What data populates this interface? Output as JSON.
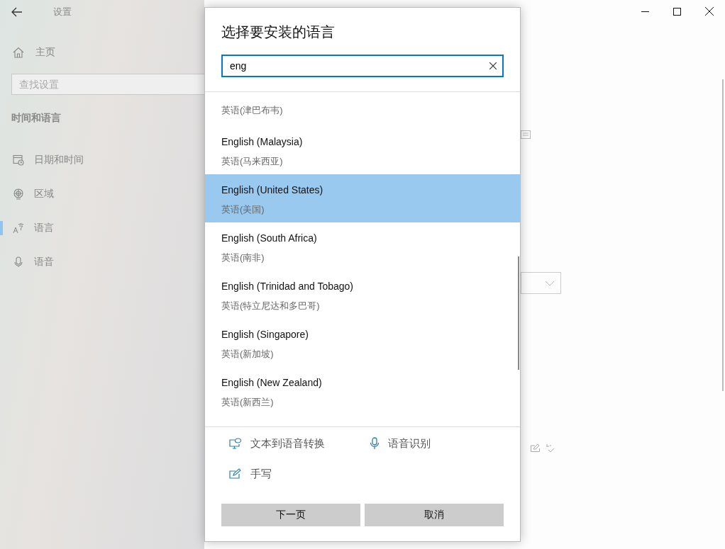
{
  "window": {
    "title": "设置"
  },
  "sidebar": {
    "home": "主页",
    "search": {
      "placeholder": "查找设置"
    },
    "section": "时间和语言",
    "items": [
      {
        "label": "日期和时间",
        "kind": "datetime",
        "selected": false
      },
      {
        "label": "区域",
        "kind": "region",
        "selected": false
      },
      {
        "label": "语言",
        "kind": "language",
        "selected": true
      },
      {
        "label": "语音",
        "kind": "speech",
        "selected": false
      }
    ]
  },
  "dialog": {
    "title": "选择要安装的语言",
    "search": {
      "value": "eng"
    },
    "languages": [
      {
        "native": "英语(津巴布韦)",
        "selected": false
      },
      {
        "name": "English (Malaysia)",
        "native": "英语(马来西亚)",
        "selected": false
      },
      {
        "name": "English (United States)",
        "native": "英语(美国)",
        "selected": true
      },
      {
        "name": "English (South Africa)",
        "native": "英语(南非)",
        "selected": false
      },
      {
        "name": "English (Trinidad and Tobago)",
        "native": "英语(特立尼达和多巴哥)",
        "selected": false
      },
      {
        "name": "English (Singapore)",
        "native": "英语(新加坡)",
        "selected": false
      },
      {
        "name": "English (New Zealand)",
        "native": "英语(新西兰)",
        "selected": false
      }
    ],
    "features": [
      {
        "label": "文本到语音转换",
        "kind": "tts"
      },
      {
        "label": "语音识别",
        "kind": "speech"
      },
      {
        "label": "手写",
        "kind": "handwriting"
      }
    ],
    "buttons": [
      "下一页",
      "取消"
    ]
  }
}
